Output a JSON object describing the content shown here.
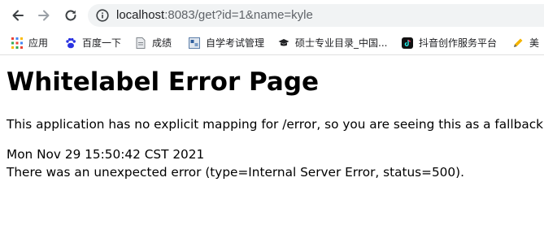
{
  "browser": {
    "url_host": "localhost",
    "url_rest": ":8083/get?id=1&name=kyle"
  },
  "bookmarks": [
    {
      "label": "应用",
      "icon": "apps-grid-icon"
    },
    {
      "label": "百度一下",
      "icon": "baidu-paw-icon"
    },
    {
      "label": "成绩",
      "icon": "document-icon"
    },
    {
      "label": "自学考试管理",
      "icon": "page-favicon-icon"
    },
    {
      "label": "硕士专业目录_中国...",
      "icon": "graduation-cap-icon"
    },
    {
      "label": "抖音创作服务平台",
      "icon": "tiktok-icon"
    },
    {
      "label": "美",
      "icon": "pencil-icon"
    }
  ],
  "page": {
    "heading": "Whitelabel Error Page",
    "message": "This application has no explicit mapping for /error, so you are seeing this as a fallback.",
    "timestamp": "Mon Nov 29 15:50:42 CST 2021",
    "error_detail": "There was an unexpected error (type=Internal Server Error, status=500)."
  },
  "colors": {
    "toolbar_icon": "#5f6368",
    "omnibox_bg": "#f1f3f4"
  }
}
